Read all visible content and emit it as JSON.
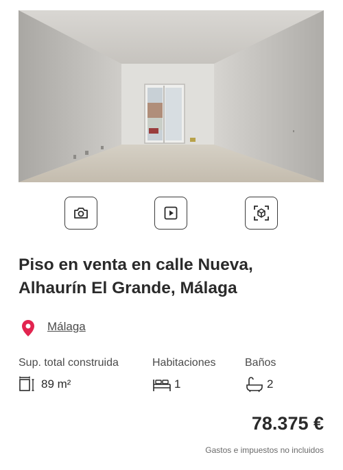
{
  "listing": {
    "title_line1": "Piso en venta en calle Nueva,",
    "title_line2": "Alhaurín El Grande, Málaga",
    "location": "Málaga",
    "features": {
      "area_label": "Sup. total construida",
      "area_value": "89 m²",
      "rooms_label": "Habitaciones",
      "rooms_value": "1",
      "baths_label": "Baños",
      "baths_value": "2"
    },
    "price": "78.375 €",
    "price_note": "Gastos e impuestos no incluidos"
  },
  "icons": {
    "photos": "camera-icon",
    "video": "play-icon",
    "tour": "3d-cube-icon",
    "location": "map-pin-icon",
    "area": "floor-area-icon",
    "rooms": "bed-icon",
    "baths": "bathtub-icon"
  },
  "colors": {
    "pin": "#e2244f",
    "text": "#2a2a2a",
    "muted": "#6a6a6a"
  }
}
